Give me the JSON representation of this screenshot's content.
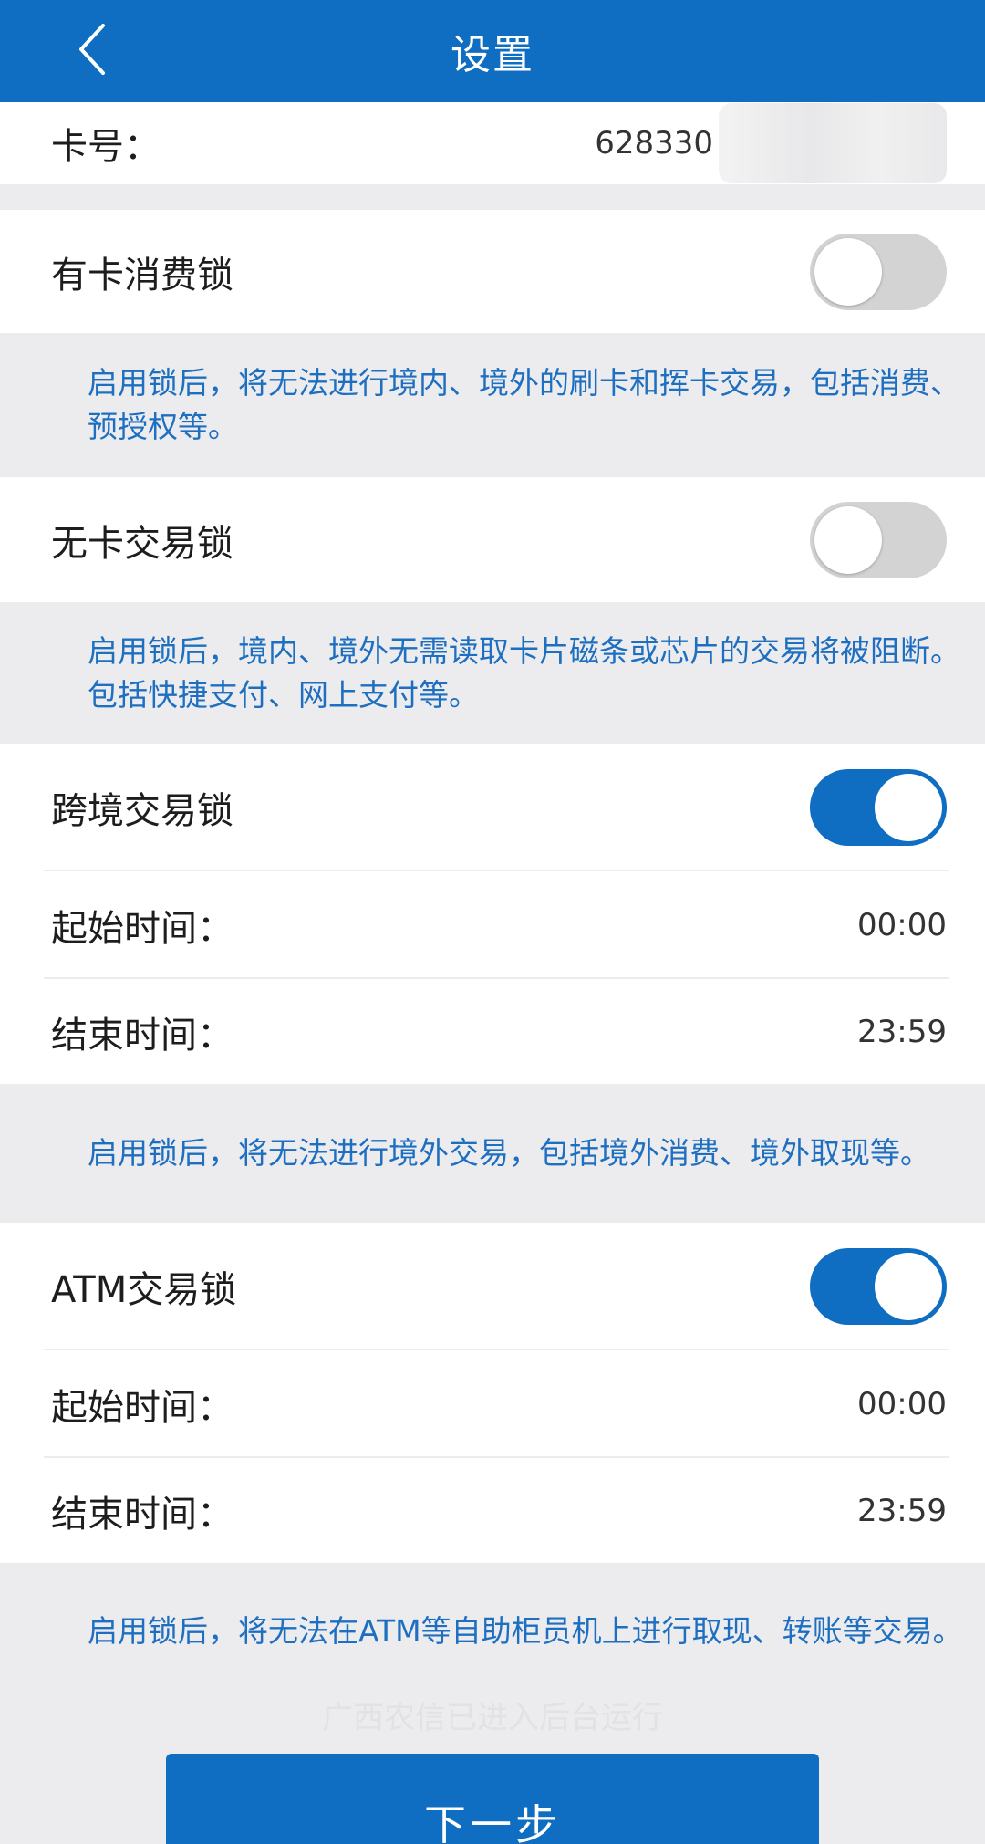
{
  "header": {
    "title": "设置"
  },
  "card": {
    "label": "卡号：",
    "number_visible": "628330"
  },
  "sections": [
    {
      "label": "有卡消费锁",
      "toggle_on": false,
      "note": "启用锁后，将无法进行境内、境外的刷卡和挥卡交易，包括消费、预授权等。"
    },
    {
      "label": "无卡交易锁",
      "toggle_on": false,
      "note": "启用锁后，境内、境外无需读取卡片磁条或芯片的交易将被阻断。包括快捷支付、网上支付等。"
    },
    {
      "label": "跨境交易锁",
      "toggle_on": true,
      "start_label": "起始时间：",
      "start_value": "00:00",
      "end_label": "结束时间：",
      "end_value": "23:59",
      "note": "启用锁后，将无法进行境外交易，包括境外消费、境外取现等。"
    },
    {
      "label": "ATM交易锁",
      "toggle_on": true,
      "start_label": "起始时间：",
      "start_value": "00:00",
      "end_label": "结束时间：",
      "end_value": "23:59",
      "note": "启用锁后，将无法在ATM等自助柜员机上进行取现、转账等交易。"
    }
  ],
  "toast": "广西农信已进入后台运行",
  "footer": {
    "next_label": "下一步"
  },
  "colors": {
    "primary": "#0f6dc2",
    "note_text": "#1e6fc0",
    "background": "#ececef"
  }
}
